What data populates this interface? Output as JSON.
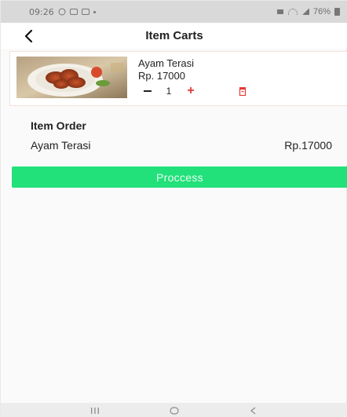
{
  "status_bar": {
    "time": "09:26",
    "battery_text": "76%",
    "icons": [
      "whatsapp-icon",
      "gallery-icon",
      "screen-icon",
      "dot-icon",
      "alarm-icon",
      "wifi-icon",
      "signal-icon",
      "battery-icon"
    ]
  },
  "app_bar": {
    "title": "Item Carts",
    "back_icon": "chevron-left-icon"
  },
  "cart": {
    "items": [
      {
        "name": "Ayam Terasi",
        "price": "Rp. 17000",
        "quantity": "1",
        "image_icon": "food-plate-image",
        "delete_icon": "trash-icon",
        "delete_color": "#e53935",
        "plus_color": "#e53935"
      }
    ]
  },
  "order": {
    "heading": "Item Order",
    "items": [
      {
        "name": "Ayam Terasi",
        "price": "Rp.17000"
      }
    ]
  },
  "actions": {
    "process_label": "Proccess",
    "process_color": "#22e07a"
  },
  "nav_bar": {
    "icons": [
      "recent-apps-icon",
      "home-icon",
      "back-icon"
    ]
  }
}
